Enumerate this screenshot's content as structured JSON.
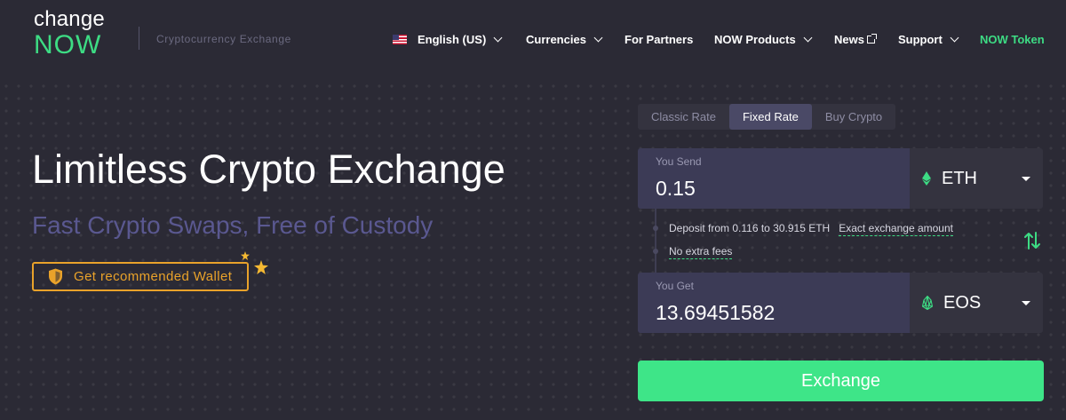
{
  "header": {
    "logo_line1": "change",
    "logo_line2": "NOW",
    "tagline": "Cryptocurrency Exchange",
    "nav": {
      "language": "English (US)",
      "currencies": "Currencies",
      "partners": "For Partners",
      "products": "NOW Products",
      "news": "News",
      "support": "Support",
      "token": "NOW Token"
    }
  },
  "hero": {
    "title": "Limitless Crypto Exchange",
    "subtitle": "Fast Crypto Swaps, Free of Custody",
    "wallet_button": "Get recommended Wallet"
  },
  "widget": {
    "tabs": [
      {
        "label": "Classic Rate",
        "active": false
      },
      {
        "label": "Fixed Rate",
        "active": true
      },
      {
        "label": "Buy Crypto",
        "active": false
      }
    ],
    "send": {
      "caption": "You Send",
      "amount": "0.15",
      "currency": "ETH"
    },
    "deposit_info": "Deposit from 0.116 to 30.915 ETH",
    "exact_amount_link": "Exact exchange amount",
    "no_fees": "No extra fees",
    "get": {
      "caption": "You Get",
      "amount": "13.69451582",
      "currency": "EOS"
    },
    "exchange_button": "Exchange"
  },
  "colors": {
    "background": "#2b2a35",
    "accent_green": "#3ddc84",
    "wallet_orange": "#e9a22a",
    "subtitle_purple": "#5a5890"
  },
  "icons": [
    "us-flag-icon",
    "chevron-down-icon",
    "external-link-icon",
    "shield-icon",
    "star-icon",
    "eth-icon",
    "eos-icon",
    "swap-arrows-icon",
    "caret-down-icon"
  ]
}
